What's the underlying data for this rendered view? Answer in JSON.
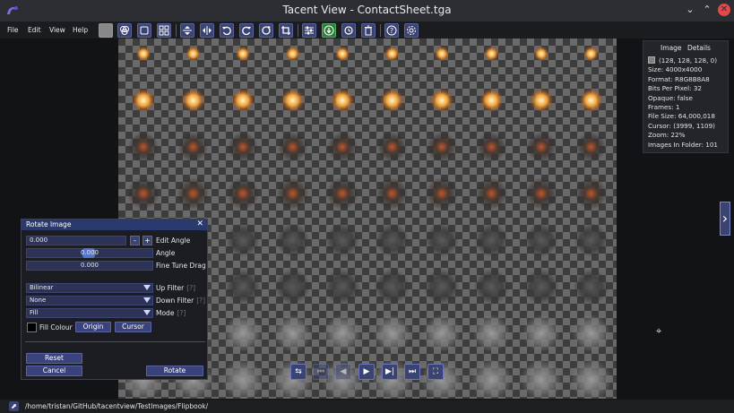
{
  "window": {
    "title": "Tacent View - ContactSheet.tga"
  },
  "menu": [
    "File",
    "Edit",
    "View",
    "Help"
  ],
  "toolbar": {
    "icons": [
      "color-swatch-icon",
      "channels-icon",
      "tile-icon",
      "content-view-icon",
      "flip-vertical-icon",
      "flip-horizontal-icon",
      "rotate-ccw-icon",
      "rotate-cw-icon",
      "rotate-free-icon",
      "crop-icon",
      "adjust-icon",
      "save-icon",
      "refresh-icon",
      "delete-icon",
      "help-icon",
      "settings-icon"
    ]
  },
  "info_panel": {
    "tabs": [
      "Image",
      "Details"
    ],
    "pixel_value": "(128, 128, 128, 0)",
    "lines": [
      "Size: 4000x4000",
      "Format: R8G8B8A8",
      "Bits Per Pixel: 32",
      "Opaque: false",
      "Frames: 1",
      "File Size: 64,000,018",
      "Cursor: (3999, 1109)",
      "Zoom: 22%",
      "Images In Folder: 101"
    ]
  },
  "dialog": {
    "title": "Rotate Image",
    "edit_angle_value": "0.000",
    "edit_angle_label": "Edit Angle",
    "angle_value": "0.000",
    "angle_label": "Angle",
    "fine_tune_value": "0.000",
    "fine_tune_label": "Fine Tune Drag",
    "up_filter_value": "Bilinear",
    "up_filter_label": "Up Filter",
    "down_filter_value": "None",
    "down_filter_label": "Down Filter",
    "mode_value": "Fill",
    "mode_label": "Mode",
    "hint": "[?]",
    "fill_colour_label": "Fill Colour",
    "origin_label": "Origin",
    "cursor_label": "Cursor",
    "reset_label": "Reset",
    "cancel_label": "Cancel",
    "rotate_label": "Rotate",
    "minus": "-",
    "plus": "+"
  },
  "status": {
    "path": "/home/tristan/GitHub/tacentview/TestImages/Flipbook/"
  },
  "colors": {
    "accent": "#3b4370",
    "titlebar": "#2c2e33",
    "close": "#e04a4a"
  }
}
